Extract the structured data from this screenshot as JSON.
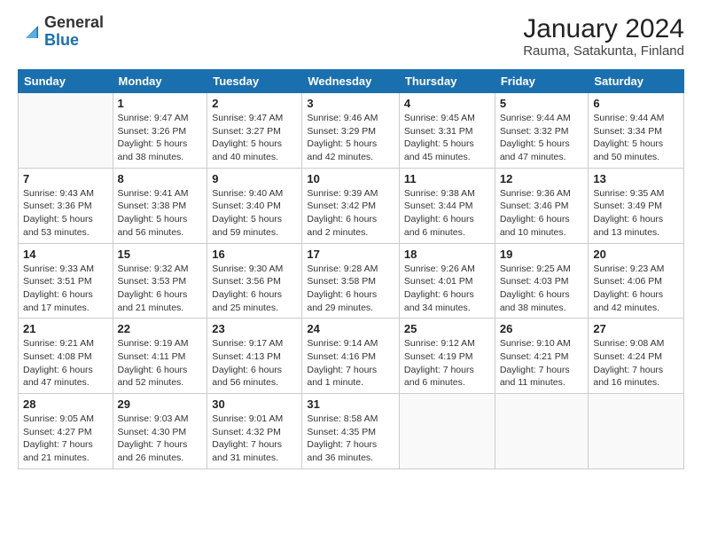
{
  "logo": {
    "general": "General",
    "blue": "Blue"
  },
  "title": "January 2024",
  "subtitle": "Rauma, Satakunta, Finland",
  "days_header": [
    "Sunday",
    "Monday",
    "Tuesday",
    "Wednesday",
    "Thursday",
    "Friday",
    "Saturday"
  ],
  "weeks": [
    [
      {
        "num": "",
        "info": ""
      },
      {
        "num": "1",
        "info": "Sunrise: 9:47 AM\nSunset: 3:26 PM\nDaylight: 5 hours\nand 38 minutes."
      },
      {
        "num": "2",
        "info": "Sunrise: 9:47 AM\nSunset: 3:27 PM\nDaylight: 5 hours\nand 40 minutes."
      },
      {
        "num": "3",
        "info": "Sunrise: 9:46 AM\nSunset: 3:29 PM\nDaylight: 5 hours\nand 42 minutes."
      },
      {
        "num": "4",
        "info": "Sunrise: 9:45 AM\nSunset: 3:31 PM\nDaylight: 5 hours\nand 45 minutes."
      },
      {
        "num": "5",
        "info": "Sunrise: 9:44 AM\nSunset: 3:32 PM\nDaylight: 5 hours\nand 47 minutes."
      },
      {
        "num": "6",
        "info": "Sunrise: 9:44 AM\nSunset: 3:34 PM\nDaylight: 5 hours\nand 50 minutes."
      }
    ],
    [
      {
        "num": "7",
        "info": "Sunrise: 9:43 AM\nSunset: 3:36 PM\nDaylight: 5 hours\nand 53 minutes."
      },
      {
        "num": "8",
        "info": "Sunrise: 9:41 AM\nSunset: 3:38 PM\nDaylight: 5 hours\nand 56 minutes."
      },
      {
        "num": "9",
        "info": "Sunrise: 9:40 AM\nSunset: 3:40 PM\nDaylight: 5 hours\nand 59 minutes."
      },
      {
        "num": "10",
        "info": "Sunrise: 9:39 AM\nSunset: 3:42 PM\nDaylight: 6 hours\nand 2 minutes."
      },
      {
        "num": "11",
        "info": "Sunrise: 9:38 AM\nSunset: 3:44 PM\nDaylight: 6 hours\nand 6 minutes."
      },
      {
        "num": "12",
        "info": "Sunrise: 9:36 AM\nSunset: 3:46 PM\nDaylight: 6 hours\nand 10 minutes."
      },
      {
        "num": "13",
        "info": "Sunrise: 9:35 AM\nSunset: 3:49 PM\nDaylight: 6 hours\nand 13 minutes."
      }
    ],
    [
      {
        "num": "14",
        "info": "Sunrise: 9:33 AM\nSunset: 3:51 PM\nDaylight: 6 hours\nand 17 minutes."
      },
      {
        "num": "15",
        "info": "Sunrise: 9:32 AM\nSunset: 3:53 PM\nDaylight: 6 hours\nand 21 minutes."
      },
      {
        "num": "16",
        "info": "Sunrise: 9:30 AM\nSunset: 3:56 PM\nDaylight: 6 hours\nand 25 minutes."
      },
      {
        "num": "17",
        "info": "Sunrise: 9:28 AM\nSunset: 3:58 PM\nDaylight: 6 hours\nand 29 minutes."
      },
      {
        "num": "18",
        "info": "Sunrise: 9:26 AM\nSunset: 4:01 PM\nDaylight: 6 hours\nand 34 minutes."
      },
      {
        "num": "19",
        "info": "Sunrise: 9:25 AM\nSunset: 4:03 PM\nDaylight: 6 hours\nand 38 minutes."
      },
      {
        "num": "20",
        "info": "Sunrise: 9:23 AM\nSunset: 4:06 PM\nDaylight: 6 hours\nand 42 minutes."
      }
    ],
    [
      {
        "num": "21",
        "info": "Sunrise: 9:21 AM\nSunset: 4:08 PM\nDaylight: 6 hours\nand 47 minutes."
      },
      {
        "num": "22",
        "info": "Sunrise: 9:19 AM\nSunset: 4:11 PM\nDaylight: 6 hours\nand 52 minutes."
      },
      {
        "num": "23",
        "info": "Sunrise: 9:17 AM\nSunset: 4:13 PM\nDaylight: 6 hours\nand 56 minutes."
      },
      {
        "num": "24",
        "info": "Sunrise: 9:14 AM\nSunset: 4:16 PM\nDaylight: 7 hours\nand 1 minute."
      },
      {
        "num": "25",
        "info": "Sunrise: 9:12 AM\nSunset: 4:19 PM\nDaylight: 7 hours\nand 6 minutes."
      },
      {
        "num": "26",
        "info": "Sunrise: 9:10 AM\nSunset: 4:21 PM\nDaylight: 7 hours\nand 11 minutes."
      },
      {
        "num": "27",
        "info": "Sunrise: 9:08 AM\nSunset: 4:24 PM\nDaylight: 7 hours\nand 16 minutes."
      }
    ],
    [
      {
        "num": "28",
        "info": "Sunrise: 9:05 AM\nSunset: 4:27 PM\nDaylight: 7 hours\nand 21 minutes."
      },
      {
        "num": "29",
        "info": "Sunrise: 9:03 AM\nSunset: 4:30 PM\nDaylight: 7 hours\nand 26 minutes."
      },
      {
        "num": "30",
        "info": "Sunrise: 9:01 AM\nSunset: 4:32 PM\nDaylight: 7 hours\nand 31 minutes."
      },
      {
        "num": "31",
        "info": "Sunrise: 8:58 AM\nSunset: 4:35 PM\nDaylight: 7 hours\nand 36 minutes."
      },
      {
        "num": "",
        "info": ""
      },
      {
        "num": "",
        "info": ""
      },
      {
        "num": "",
        "info": ""
      }
    ]
  ]
}
